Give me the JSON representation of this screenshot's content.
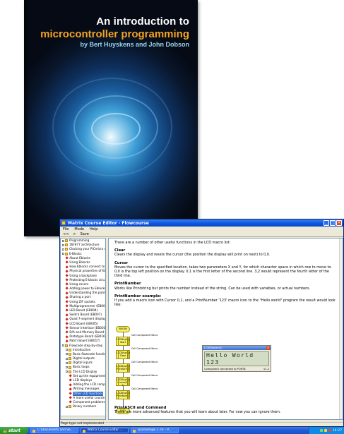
{
  "book": {
    "title_line1": "An introduction to",
    "title_line2": "microcontroller programming",
    "authors": "by Bert Huyskens and John Dobson"
  },
  "window": {
    "title": "Matrix Course Editor - Flowcourse",
    "menu": [
      "File",
      "Mode",
      "Help"
    ],
    "toolbar": {
      "back": "<<",
      "forward": ">",
      "save": "Save"
    }
  },
  "tree": [
    {
      "label": "Programming",
      "icon": "folder-icon"
    },
    {
      "label": "16F877 architecture",
      "icon": "folder-icon"
    },
    {
      "label": "Clocking your PICmicro device",
      "icon": "folder-icon"
    },
    {
      "label": "E-Blocks",
      "icon": "folder-icon"
    },
    {
      "label": "About Eblocks",
      "icon": "page-icon"
    },
    {
      "label": "Using Eblocks",
      "icon": "page-icon"
    },
    {
      "label": "How Eblocks connect to",
      "icon": "page-icon"
    },
    {
      "label": "Physical properties of Eb",
      "icon": "page-icon"
    },
    {
      "label": "Using a backplane",
      "icon": "page-icon"
    },
    {
      "label": "Protecting E-blocks circui",
      "icon": "page-icon"
    },
    {
      "label": "Using covers",
      "icon": "page-icon"
    },
    {
      "label": "Adding power to Eblocks",
      "icon": "page-icon"
    },
    {
      "label": "Understanding the patch",
      "icon": "page-icon"
    },
    {
      "label": "Sharing a port",
      "icon": "page-icon"
    },
    {
      "label": "Using ZIF sockets",
      "icon": "page-icon"
    },
    {
      "label": "Multiprogrammer (EB006)",
      "icon": "page-icon"
    },
    {
      "label": "LED Board (EB004)",
      "icon": "page-icon"
    },
    {
      "label": "Switch Board (EB007)",
      "icon": "page-icon"
    },
    {
      "label": "Quad 7-segment display (",
      "icon": "page-icon"
    },
    {
      "label": "LCD Board (EB005)",
      "icon": "page-icon"
    },
    {
      "label": "Sensor Interface (EB003)",
      "icon": "page-icon"
    },
    {
      "label": "D/A and Memory Board (",
      "icon": "page-icon"
    },
    {
      "label": "Prototype Board (EB016)",
      "icon": "page-icon"
    },
    {
      "label": "Patch Board (EB017)",
      "icon": "page-icon"
    },
    {
      "label": "Flowcode step-by-step",
      "icon": "folder-icon"
    },
    {
      "label": "Introduction",
      "icon": "folder-icon"
    },
    {
      "label": "Basic flowcode functions",
      "icon": "folder-icon"
    },
    {
      "label": "Digital outputs",
      "icon": "folder-icon"
    },
    {
      "label": "Digital inputs",
      "icon": "folder-icon"
    },
    {
      "label": "Basic loops",
      "icon": "folder-icon"
    },
    {
      "label": "The LCD Display",
      "icon": "folder-icon"
    },
    {
      "label": "Set up the equipment",
      "icon": "page-icon"
    },
    {
      "label": "LCD displays",
      "icon": "page-icon"
    },
    {
      "label": "Adding the LCD comp",
      "icon": "page-icon"
    },
    {
      "label": "Writing messages",
      "icon": "page-icon"
    },
    {
      "label": "Other LCD functions",
      "icon": "page-icon",
      "selected": true
    },
    {
      "label": "A more useful counte",
      "icon": "page-icon"
    },
    {
      "label": "Component problems",
      "icon": "page-icon"
    },
    {
      "label": "Binary numbers",
      "icon": "folder-icon"
    }
  ],
  "content": {
    "intro": "There are a number of other useful functions in the LCD macro list:",
    "clear_h": "Clear",
    "clear_p": "Clears the display and resets the cursor (the position the display will print on next) to 0,0.",
    "cursor_h": "Cursor",
    "cursor_p1": "Moves the cursor to the specified location. takes two parameters X and Y, for which character space in which row to move to.",
    "cursor_p2": "0,0 is the top left position on the display. 0,1 is the first letter of the second line. 3,2 would represent the fourth letter of the third line.",
    "printnumber_h": "PrintNumber",
    "printnumber_p": "Works like Printstring but prints the number instead of the string. Can be used with variables, or actual numbers.",
    "example_h": "PrintNumber example:",
    "example_p": "If you add a macro icon with Cursor 0,1, and a PrintNumber '123' macro icon to the \"Hello world\" program the result would look like:",
    "printascii_h": "PrintASCII and Command",
    "printascii_p": "These are more advanced features that you will learn about later. For now you can ignore them."
  },
  "flowchart": {
    "begin": "BEGIN",
    "end": "END",
    "boxes": [
      {
        "text": "LCDDisplay Start",
        "label": "Call Component Macro"
      },
      {
        "text": "LCDDisplay Clear",
        "label": "Call Component Macro"
      },
      {
        "text": "LCDDisplay PrintString",
        "label": "Call Component Macro"
      },
      {
        "text": "LCDDisplay Cursor(0, 1)",
        "label": "Call Component Macro"
      },
      {
        "text": "LCDDisplay PrintNumb..",
        "label": "Call Component Macro"
      }
    ]
  },
  "lcd": {
    "title": "LCDDisplay(0)",
    "line1": "Hello World",
    "line2": "123",
    "status": "Component connected to PORTB",
    "version": "v1.2"
  },
  "statusbar": {
    "text": "Page type not implemented"
  },
  "taskbar": {
    "start": "start",
    "tasks": [
      "C:\\Documents and Se...",
      "Matrix Course Editor ...",
      "sparkimage 1.TIF - P..."
    ],
    "clock": "14:27"
  },
  "colors": {
    "titlebar": "#0846c4",
    "taskbar": "#245edb",
    "start": "#2f9a2f",
    "lcd_screen": "#d3dcc4",
    "flow_block": "#f7f06a",
    "book_title_accent": "#f3a21f"
  }
}
